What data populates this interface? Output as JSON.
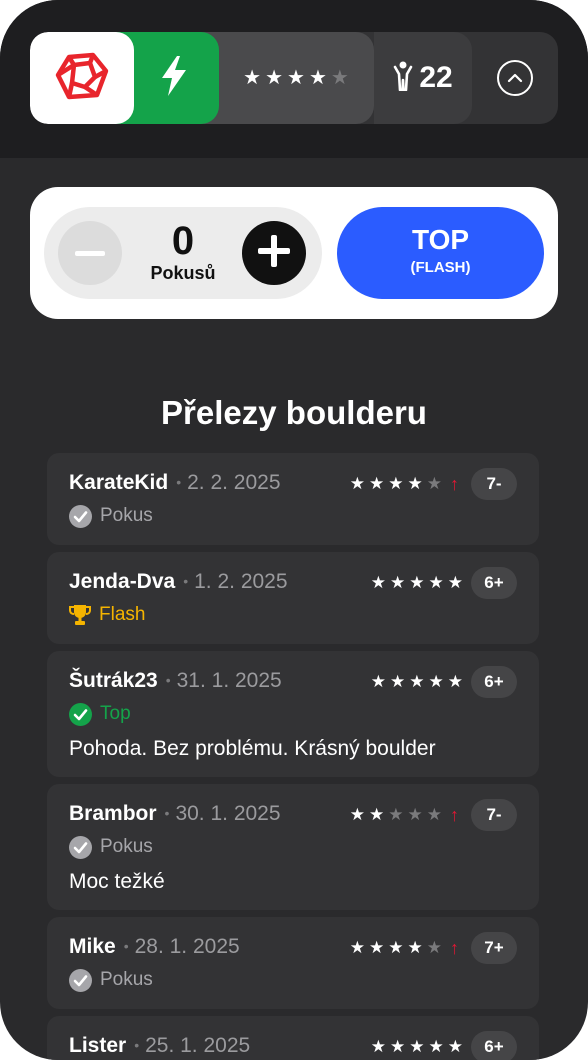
{
  "header": {
    "rating_stars": 4,
    "rating_max": 5,
    "climbers_count": "22",
    "icons": {
      "logo": "gem-logo-icon",
      "flash": "lightning-icon",
      "climber": "climber-icon",
      "toggle": "chevron-up-icon"
    }
  },
  "attempt": {
    "count": "0",
    "count_label": "Pokusů",
    "top_label": "TOP",
    "top_sublabel": "(FLASH)"
  },
  "section": {
    "title": "Přelezy boulderu"
  },
  "colors": {
    "flash_green": "#14a34a",
    "top_blue": "#2b5cff",
    "logo_red": "#e8252c",
    "grade_up_red": "#e01733",
    "flash_gold": "#f5b400"
  },
  "ascents": [
    {
      "user": "KarateKid",
      "date": "2. 2. 2025",
      "stars": 4,
      "grade_up": true,
      "grade": "7-",
      "status": "Pokus",
      "status_type": "pokus",
      "comment": ""
    },
    {
      "user": "Jenda-Dva",
      "date": "1. 2. 2025",
      "stars": 5,
      "grade_up": false,
      "grade": "6+",
      "status": "Flash",
      "status_type": "flash",
      "comment": ""
    },
    {
      "user": "Šutrák23",
      "date": "31. 1. 2025",
      "stars": 5,
      "grade_up": false,
      "grade": "6+",
      "status": "Top",
      "status_type": "top",
      "comment": "Pohoda. Bez problému. Krásný boulder"
    },
    {
      "user": "Brambor",
      "date": "30. 1. 2025",
      "stars": 2,
      "grade_up": true,
      "grade": "7-",
      "status": "Pokus",
      "status_type": "pokus",
      "comment": "Moc težké"
    },
    {
      "user": "Mike",
      "date": "28. 1. 2025",
      "stars": 4,
      "grade_up": true,
      "grade": "7+",
      "status": "Pokus",
      "status_type": "pokus",
      "comment": ""
    },
    {
      "user": "Lister",
      "date": "25. 1. 2025",
      "stars": 5,
      "grade_up": false,
      "grade": "6+",
      "status": "",
      "status_type": "",
      "comment": ""
    }
  ]
}
